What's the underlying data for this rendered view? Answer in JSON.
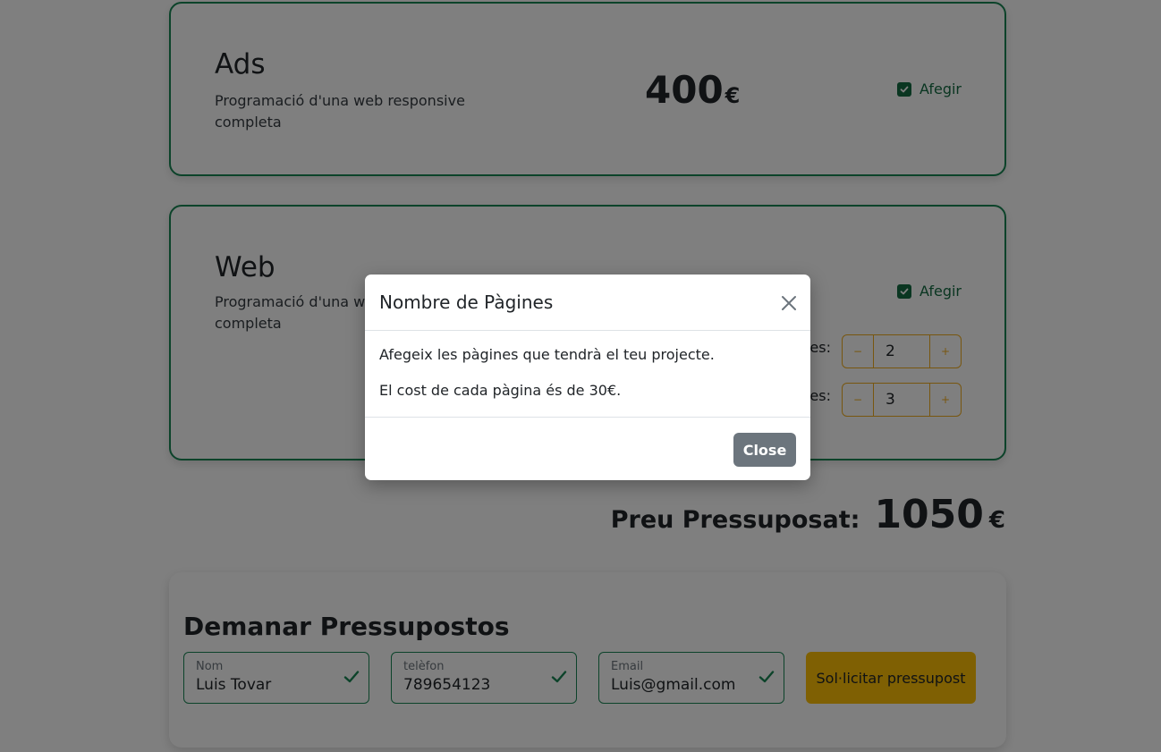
{
  "services": {
    "ads": {
      "title": "Ads",
      "description": "Programació d'una web responsive completa",
      "price": "400",
      "currency": "€",
      "checkbox_label": "Afegir",
      "checked": true
    },
    "web": {
      "title": "Web",
      "description": "Programació d'una web responsive completa",
      "checkbox_label": "Afegir",
      "checked": true,
      "pages_label_tail": "es:",
      "languages_label_tail": "es:",
      "pages_value": "2",
      "languages_value": "3",
      "minus_symbol": "−",
      "plus_symbol": "+"
    }
  },
  "total": {
    "label": "Preu Pressuposat:",
    "value": "1050",
    "currency": "€"
  },
  "form": {
    "title": "Demanar Pressupostos",
    "fields": [
      {
        "label": "Nom",
        "value": "Luis Tovar"
      },
      {
        "label": "telèfon",
        "value": "789654123"
      },
      {
        "label": "Email",
        "value": "Luis@gmail.com"
      }
    ],
    "submit_label": "Sol·licitar pressupost"
  },
  "modal": {
    "title": "Nombre de Pàgines",
    "body": [
      "Afegeix les pàgines que tendrà el teu projecte.",
      "El cost de cada pàgina és de 30€."
    ],
    "close_label": "Close"
  },
  "colors": {
    "accent_green": "#198754",
    "accent_yellow": "#ffc107",
    "close_gray": "#6c757d"
  }
}
